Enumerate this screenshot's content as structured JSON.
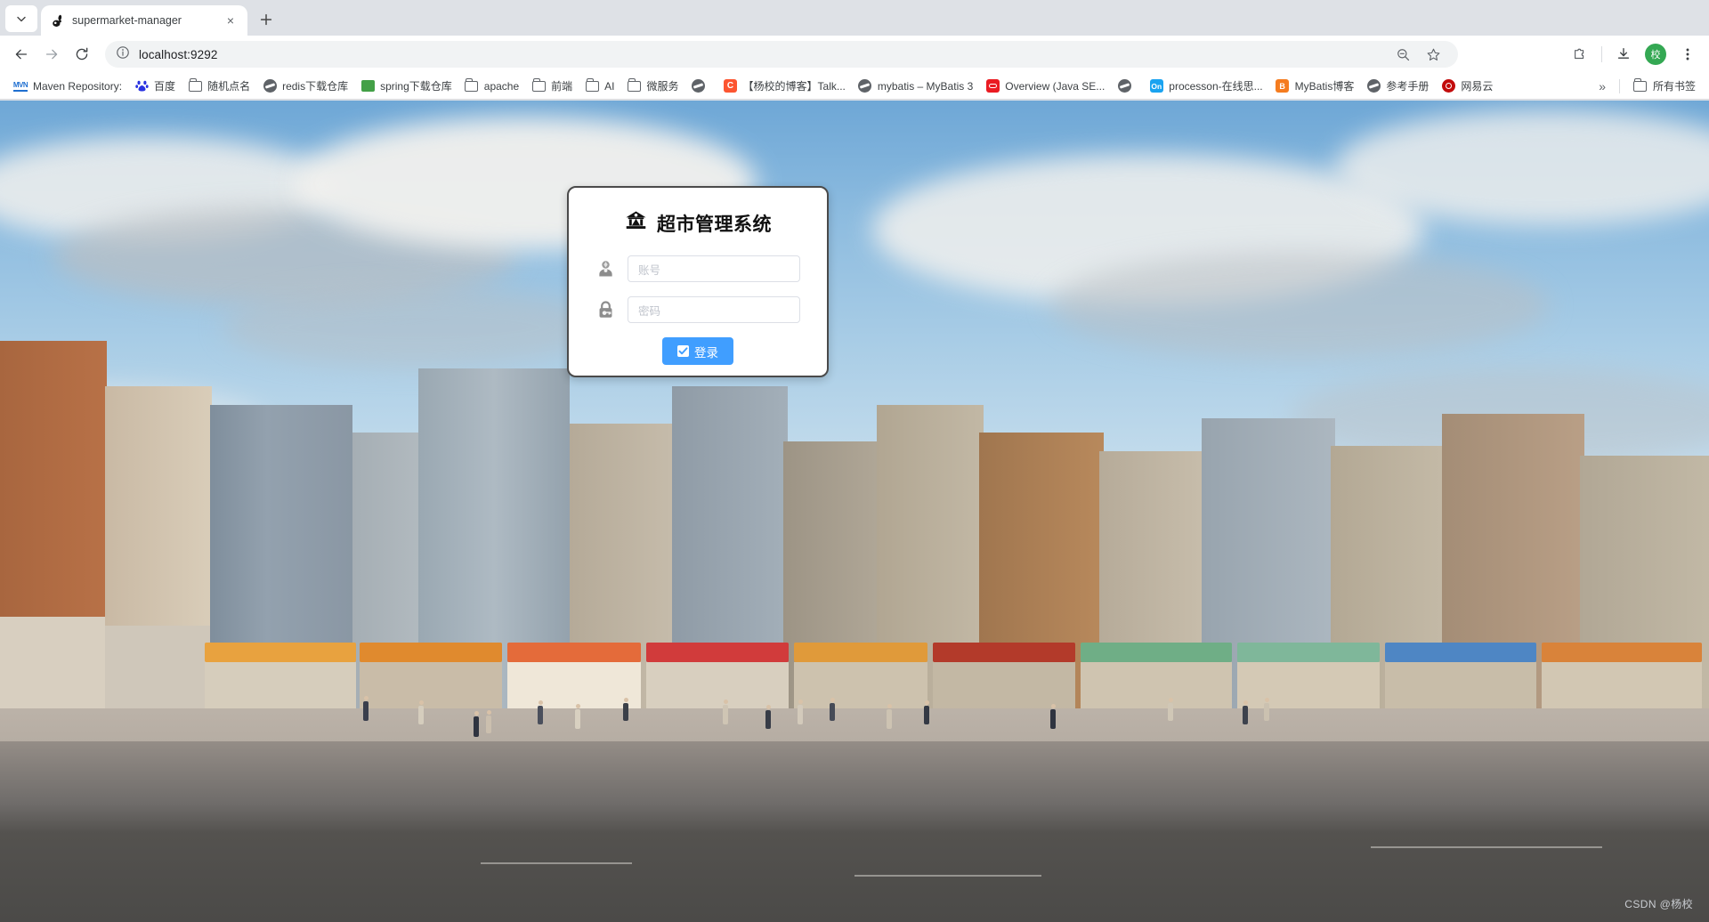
{
  "browser": {
    "tab": {
      "title": "supermarket-manager",
      "favicon": "bunny-icon",
      "close": "×"
    },
    "new_tab_label": "+",
    "tab_list_chevron": "chevron-down-icon",
    "nav": {
      "back": "←",
      "forward": "→",
      "reload": "↻"
    },
    "omnibox": {
      "site_info_icon": "info-circle-icon",
      "url": "localhost:9292",
      "zoom_out_icon": "zoom-out-icon",
      "bookmark_icon": "star-icon"
    },
    "toolbar_right": {
      "extensions_icon": "puzzle-icon",
      "downloads_icon": "download-icon",
      "profile_initial": "校",
      "menu_icon": "kebab-menu-icon"
    },
    "bookmarks": [
      {
        "label": "Maven Repository:",
        "icon": "mvn-icon"
      },
      {
        "label": "百度",
        "icon": "baidu-icon"
      },
      {
        "label": "随机点名",
        "icon": "folder-icon"
      },
      {
        "label": "redis下载仓库",
        "icon": "globe-icon"
      },
      {
        "label": "spring下载仓库",
        "icon": "jfrog-icon"
      },
      {
        "label": "apache",
        "icon": "folder-icon"
      },
      {
        "label": "前端",
        "icon": "folder-icon"
      },
      {
        "label": "AI",
        "icon": "folder-icon"
      },
      {
        "label": "微服务",
        "icon": "folder-icon"
      },
      {
        "label": "",
        "icon": "globe-icon"
      },
      {
        "label": "【杨校的博客】Talk...",
        "icon": "csdn-icon"
      },
      {
        "label": "mybatis – MyBatis 3",
        "icon": "globe-icon"
      },
      {
        "label": "Overview (Java SE...",
        "icon": "oracle-icon"
      },
      {
        "label": "",
        "icon": "globe-icon"
      },
      {
        "label": "processon-在线思...",
        "icon": "processon-icon"
      },
      {
        "label": "MyBatis博客",
        "icon": "blogger-icon"
      },
      {
        "label": "参考手册",
        "icon": "globe-icon"
      },
      {
        "label": "网易云",
        "icon": "netease-icon"
      }
    ],
    "bookmarks_overflow": "»",
    "all_bookmarks": {
      "label": "所有书签",
      "icon": "folder-icon"
    }
  },
  "login": {
    "brand_icon": "bank-store-icon",
    "title": "超市管理系统",
    "username": {
      "icon": "user-icon",
      "value": "",
      "placeholder": "账号"
    },
    "password": {
      "icon": "lock-key-icon",
      "value": "",
      "placeholder": "密码"
    },
    "submit": {
      "label": "登录",
      "icon": "check-square-icon",
      "color": "#409eff"
    }
  },
  "watermark": "CSDN @杨校",
  "colors": {
    "accent": "#409eff",
    "card_border": "#4a4a4a",
    "placeholder": "#c0c4cc",
    "avatar": "#34a853"
  }
}
